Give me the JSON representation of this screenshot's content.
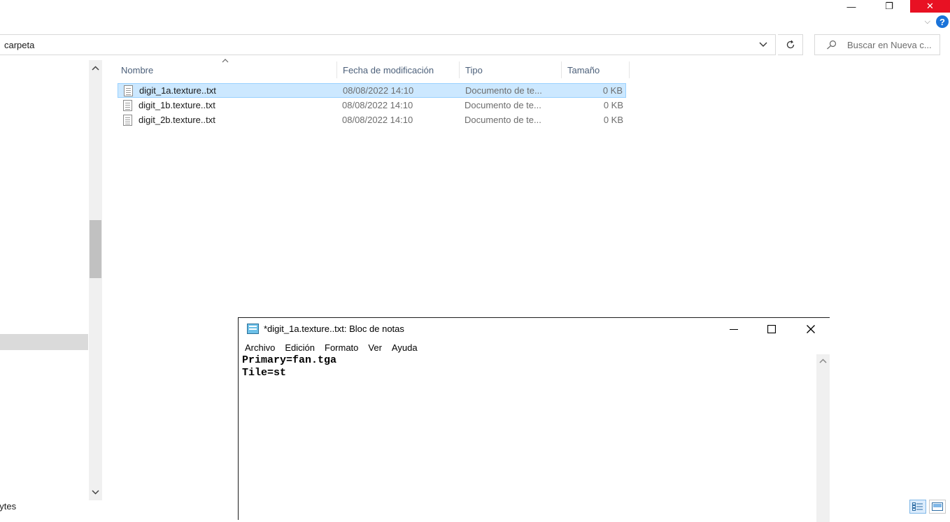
{
  "explorer": {
    "window_buttons": {
      "minimize": "—",
      "restore": "❐",
      "close": "✕"
    },
    "help": "?",
    "address": {
      "path": "carpeta"
    },
    "search": {
      "placeholder": "Buscar en Nueva c..."
    },
    "columns": [
      "Nombre",
      "Fecha de modificación",
      "Tipo",
      "Tamaño"
    ],
    "files": [
      {
        "name": "digit_1a.texture..txt",
        "date": "08/08/2022 14:10",
        "type": "Documento de te...",
        "size": "0 KB"
      },
      {
        "name": "digit_1b.texture..txt",
        "date": "08/08/2022 14:10",
        "type": "Documento de te...",
        "size": "0 KB"
      },
      {
        "name": "digit_2b.texture..txt",
        "date": "08/08/2022 14:10",
        "type": "Documento de te...",
        "size": "0 KB"
      }
    ],
    "status": "bytes"
  },
  "notepad": {
    "title": "*digit_1a.texture..txt: Bloc de notas",
    "menu": [
      "Archivo",
      "Edición",
      "Formato",
      "Ver",
      "Ayuda"
    ],
    "content_lines": [
      "Primary=fan.tga",
      "Tile=st"
    ]
  },
  "colors": {
    "selection": "#cce8ff",
    "close_red": "#e81123",
    "header_text": "#4c607a",
    "help_blue": "#1a73d9"
  }
}
